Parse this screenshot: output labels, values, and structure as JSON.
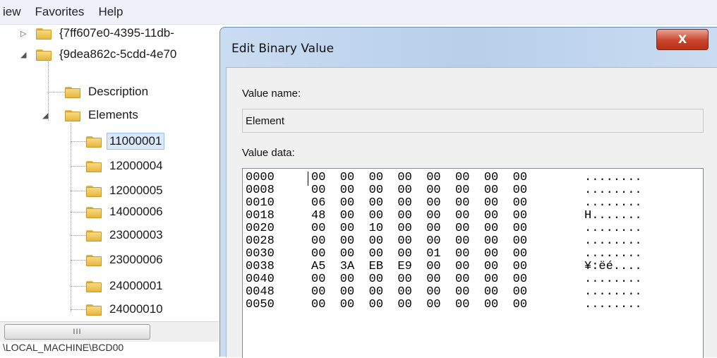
{
  "menu": {
    "items": [
      "iew",
      "Favorites",
      "Help"
    ]
  },
  "tree": {
    "nodes": [
      {
        "label": "{7ff607e0-4395-11db-",
        "expanded": false
      },
      {
        "label": "{9dea862c-5cdd-4e70",
        "expanded": true
      },
      {
        "label": "Description"
      },
      {
        "label": "Elements",
        "expanded": true
      },
      {
        "label": "11000001",
        "selected": true
      },
      {
        "label": "12000004"
      },
      {
        "label": "12000005"
      },
      {
        "label": "14000006"
      },
      {
        "label": "23000003"
      },
      {
        "label": "23000006"
      },
      {
        "label": "24000001"
      },
      {
        "label": "24000010"
      }
    ],
    "scroll_thumb_glyph": "III"
  },
  "status_text": "\\LOCAL_MACHINE\\BCD00",
  "dialog": {
    "title": "Edit Binary Value",
    "close_label": "X",
    "value_name_label": "Value name:",
    "value_name": "Element",
    "value_data_label": "Value data:",
    "rows": [
      {
        "addr": "0000",
        "bytes": "00  00  00  00  00  00  00  00",
        "ascii": "........"
      },
      {
        "addr": "0008",
        "bytes": "00  00  00  00  00  00  00  00",
        "ascii": "........"
      },
      {
        "addr": "0010",
        "bytes": "06  00  00  00  00  00  00  00",
        "ascii": "........"
      },
      {
        "addr": "0018",
        "bytes": "48  00  00  00  00  00  00  00",
        "ascii": "H......."
      },
      {
        "addr": "0020",
        "bytes": "00  00  10  00  00  00  00  00",
        "ascii": "........"
      },
      {
        "addr": "0028",
        "bytes": "00  00  00  00  00  00  00  00",
        "ascii": "........"
      },
      {
        "addr": "0030",
        "bytes": "00  00  00  00  01  00  00  00",
        "ascii": "........"
      },
      {
        "addr": "0038",
        "bytes": "A5  3A  EB  E9  00  00  00  00",
        "ascii": "¥:ëé...."
      },
      {
        "addr": "0040",
        "bytes": "00  00  00  00  00  00  00  00",
        "ascii": "........"
      },
      {
        "addr": "0048",
        "bytes": "00  00  00  00  00  00  00  00",
        "ascii": "........"
      },
      {
        "addr": "0050",
        "bytes": "00  00  00  00  00  00  00  00",
        "ascii": "........"
      }
    ]
  },
  "colors": {
    "close_button": "#c9452b",
    "dialog_frame": "#c9dcf1",
    "selection": "#d9e8fb"
  },
  "icons": {
    "folder": "folder-icon",
    "close": "close-icon"
  }
}
